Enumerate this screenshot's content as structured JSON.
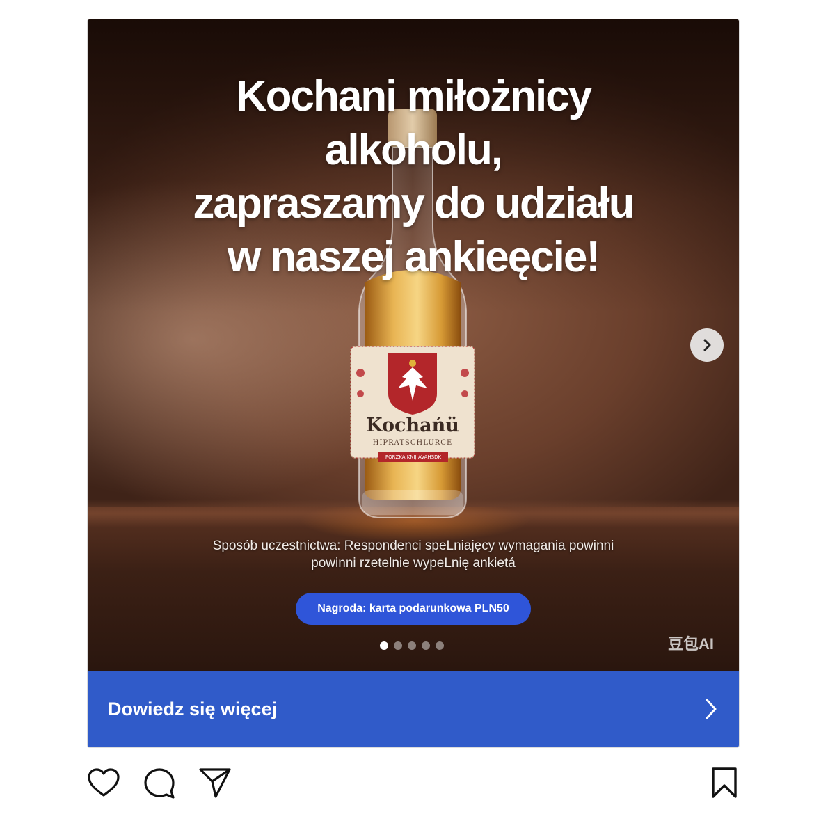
{
  "post": {
    "headline_lines": [
      "Kochani miłożnicy",
      "alkoholu,",
      "zapraszamy do udziału",
      "w naszej ankieęcie!"
    ],
    "participation_lines": [
      "Sposób uczestnictwa: Respondenci speLniajęcy wymagania powinni",
      "powinni rzetelnie wypeLnię ankietá"
    ],
    "prize_label": "Nagroda: karta podarunkowa PLN50",
    "watermark": "豆包AI",
    "bottle_label": {
      "brand": "Kochańü",
      "subtitle": "HIPRATSCHLURCE",
      "band_text": "PORZKA KNIJ AVAHSDK"
    },
    "carousel": {
      "total": 5,
      "active_index": 0
    },
    "cta_label": "Dowiedz się więcej"
  },
  "icons": {
    "next": "chevron-right-icon",
    "cta_chevron": "chevron-right-icon",
    "like": "heart-icon",
    "comment": "comment-bubble-icon",
    "share": "paper-plane-icon",
    "save": "bookmark-icon"
  },
  "colors": {
    "cta_background": "#305bc9",
    "prize_pill": "#2f55d9",
    "label_red": "#b3262a"
  }
}
